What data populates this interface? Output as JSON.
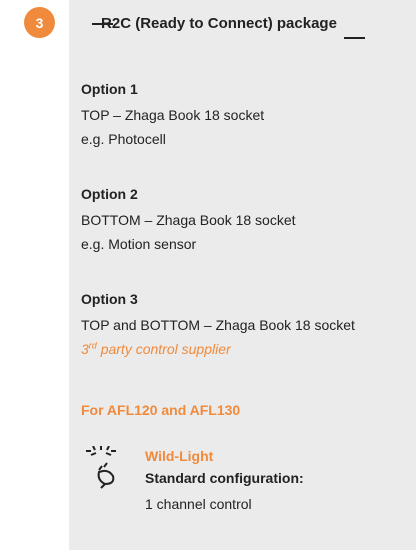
{
  "step": {
    "number": "3"
  },
  "header": {
    "title": "R2C (Ready to Connect) package"
  },
  "options": [
    {
      "title": "Option 1",
      "location": "TOP – Zhaga Book 18 socket",
      "example": "e.g. Photocell"
    },
    {
      "title": "Option 2",
      "location": "BOTTOM – Zhaga Book 18 socket",
      "example": "e.g. Motion sensor"
    },
    {
      "title": "Option 3",
      "location": "TOP and BOTTOM – Zhaga Book 18 socket",
      "note_prefix": "3",
      "note_sup": "rd",
      "note_rest": " party control supplier"
    }
  ],
  "compatibility": {
    "label": "For AFL120 and AFL130"
  },
  "wild_light": {
    "icon": "wild-light-icon",
    "title": "Wild-Light",
    "config_label": "Standard configuration:",
    "config_value": "1 channel control"
  },
  "colors": {
    "accent": "#f08a3c",
    "panel_bg": "#ebebeb",
    "text": "#222222"
  }
}
